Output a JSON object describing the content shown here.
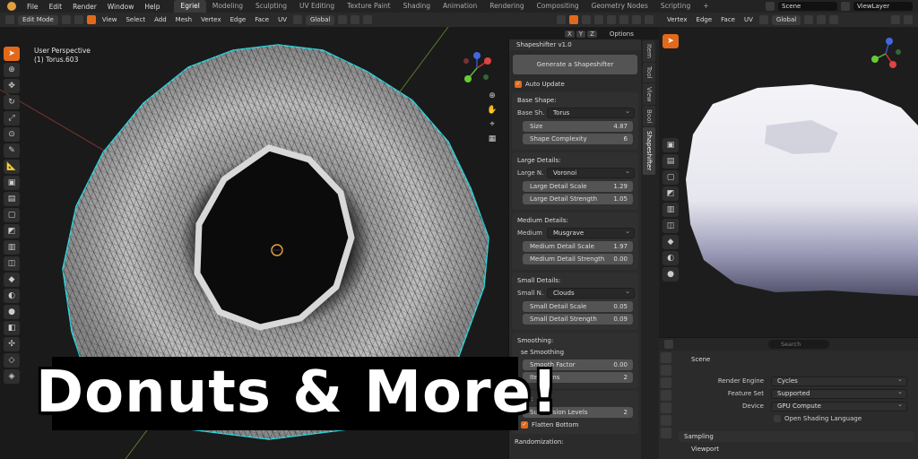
{
  "menubar": {
    "items": [
      "File",
      "Edit",
      "Render",
      "Window",
      "Help"
    ],
    "workspaces": [
      "Egriel",
      "Modeling",
      "Sculpting",
      "UV Editing",
      "Texture Paint",
      "Shading",
      "Animation",
      "Rendering",
      "Compositing",
      "Geometry Nodes",
      "Scripting"
    ],
    "active_workspace": "Egriel",
    "scene": "Scene",
    "view_layer": "ViewLayer"
  },
  "viewport_header": {
    "mode": "Edit Mode",
    "menus": [
      "View",
      "Select",
      "Add",
      "Mesh",
      "Vertex",
      "Edge",
      "Face",
      "UV"
    ],
    "transform": "Global",
    "axes": [
      "X",
      "Y",
      "Z"
    ],
    "options": "Options"
  },
  "viewport2_header": {
    "menus": [
      "Vertex",
      "Edge",
      "Face",
      "UV"
    ],
    "transform": "Global"
  },
  "viewport_overlay": {
    "perspective": "User Perspective",
    "object": "(1) Torus.603"
  },
  "npanel": {
    "title": "Shapeshifter v1.0",
    "generate_label": "Generate a Shapeshifter",
    "auto_update": "Auto Update",
    "base_shape": {
      "title": "Base Shape:",
      "shape_label": "Base Sh...",
      "shape_value": "Torus",
      "size_label": "Size",
      "size_value": "4.87",
      "complexity_label": "Shape Complexity",
      "complexity_value": "6"
    },
    "large": {
      "title": "Large Details:",
      "noise_label": "Large N...",
      "noise_value": "Voronoi",
      "scale_label": "Large Detail Scale",
      "scale_value": "1.29",
      "strength_label": "Large Detail Strength",
      "strength_value": "1.05"
    },
    "medium": {
      "title": "Medium Details:",
      "noise_label": "Medium ...",
      "noise_value": "Musgrave",
      "scale_label": "Medium Detail Scale",
      "scale_value": "1.97",
      "strength_label": "Medium Detail Strength",
      "strength_value": "0.00"
    },
    "small": {
      "title": "Small Details:",
      "noise_label": "Small N...",
      "noise_value": "Clouds",
      "scale_label": "Small Detail Scale",
      "scale_value": "0.05",
      "strength_label": "Small Detail Strength",
      "strength_value": "0.09"
    },
    "smoothing": {
      "title": "Smoothing:",
      "use_label": "se Smoothing",
      "factor_label": "Smooth Factor",
      "factor_value": "0.00",
      "iter_label": "Iterations",
      "iter_value": "2"
    },
    "refine": {
      "title": "ents:",
      "subdiv_label": "Subdivision Levels",
      "subdiv_value": "2",
      "flatten_label": "Flatten Bottom"
    },
    "random_title": "Randomization:"
  },
  "vtabs": [
    "Item",
    "Tool",
    "View",
    "Bool",
    "Shapeshifter"
  ],
  "properties": {
    "search_placeholder": "Search",
    "scene_label": "Scene",
    "render_engine_label": "Render Engine",
    "render_engine_value": "Cycles",
    "feature_set_label": "Feature Set",
    "feature_set_value": "Supported",
    "device_label": "Device",
    "device_value": "GPU Compute",
    "osl_label": "Open Shading Language",
    "sampling": "Sampling",
    "viewport": "Viewport"
  },
  "overlay_title": "Donuts & More!",
  "colors": {
    "accent": "#e2691b",
    "panel": "#2b2b2b",
    "slider": "#545454",
    "wire_highlight": "#2fd6e0"
  }
}
